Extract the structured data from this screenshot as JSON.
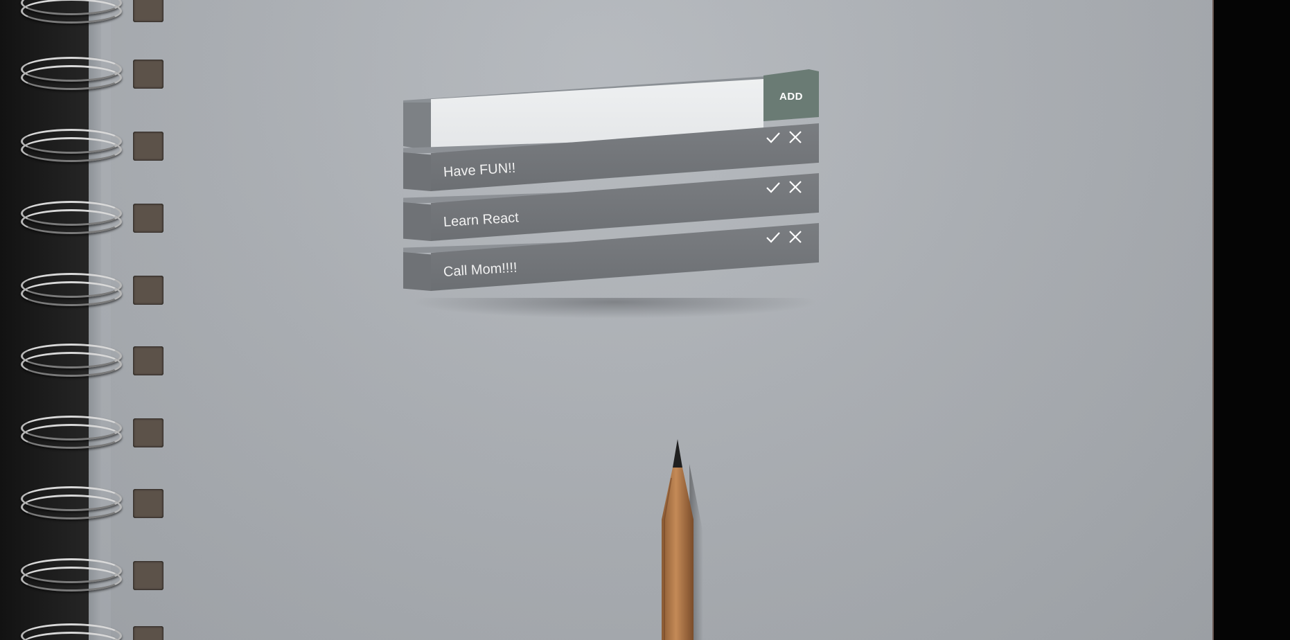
{
  "form": {
    "input_value": "",
    "input_placeholder": "",
    "add_label": "ADD"
  },
  "tasks": [
    {
      "label": "Have FUN!!",
      "done_icon": "check-icon",
      "delete_icon": "close-icon"
    },
    {
      "label": "Learn React",
      "done_icon": "check-icon",
      "delete_icon": "close-icon"
    },
    {
      "label": "Call Mom!!!!",
      "done_icon": "check-icon",
      "delete_icon": "close-icon"
    }
  ],
  "colors": {
    "background_paper": "#aaaeb3",
    "input_bg": "#eef0f1",
    "add_button": "#6a7b74",
    "task_face": "#72757a",
    "task_text": "#f1f1f1"
  }
}
